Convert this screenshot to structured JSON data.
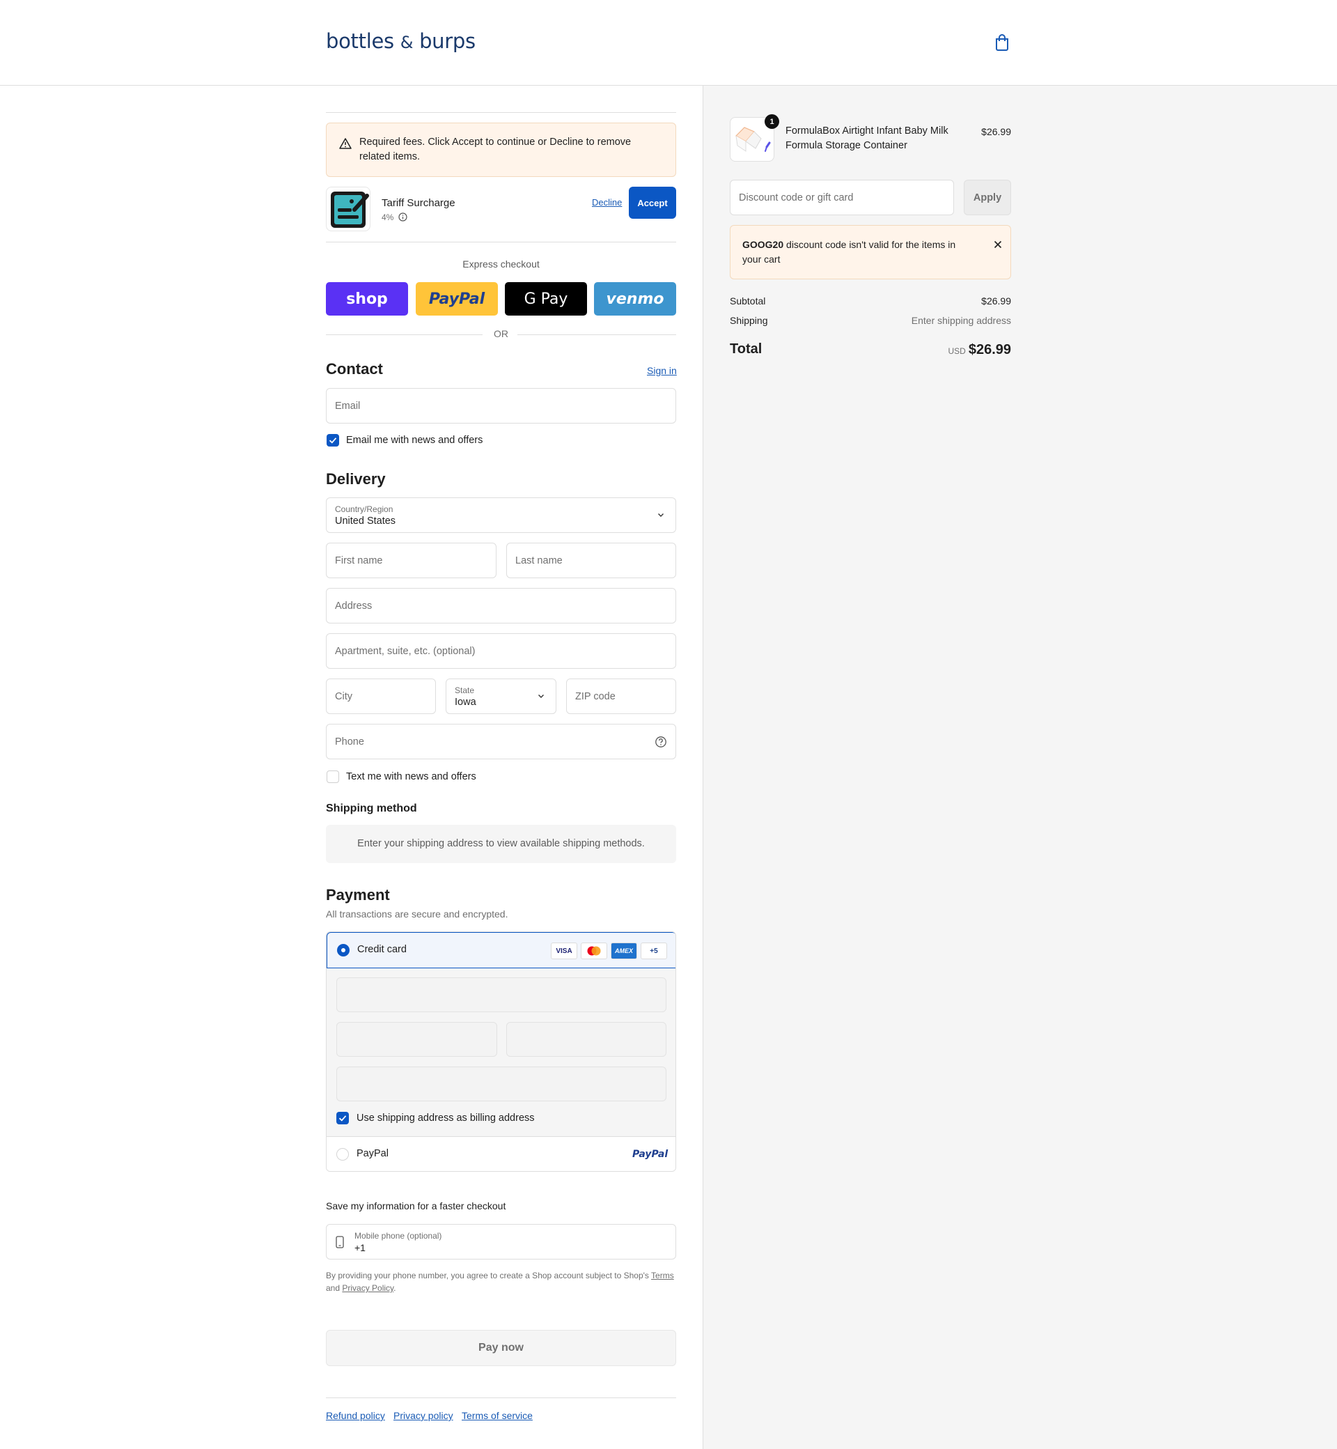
{
  "header": {
    "logo_text": "bottles",
    "logo_amp": "&",
    "logo_text2": "burps",
    "cart_icon": "shopping-bag-icon"
  },
  "fees_notice": {
    "icon": "warning-triangle-icon",
    "text": "Required fees. Click Accept to continue or Decline to remove related items."
  },
  "tariff": {
    "name": "Tariff Surcharge",
    "percent": "4%",
    "decline_label": "Decline",
    "accept_label": "Accept",
    "info_icon": "info-icon"
  },
  "express": {
    "title": "Express checkout",
    "buttons": [
      "shop",
      "PayPal",
      "G Pay",
      "venmo"
    ],
    "or_label": "OR"
  },
  "contact": {
    "title": "Contact",
    "sign_in_label": "Sign in",
    "email_placeholder": "Email",
    "newsletter_label": "Email me with news and offers",
    "newsletter_checked": true
  },
  "delivery": {
    "title": "Delivery",
    "country_label": "Country/Region",
    "country_value": "United States",
    "first_name_placeholder": "First name",
    "last_name_placeholder": "Last name",
    "address_placeholder": "Address",
    "apartment_placeholder": "Apartment, suite, etc. (optional)",
    "city_placeholder": "City",
    "state_label": "State",
    "state_value": "Iowa",
    "zip_placeholder": "ZIP code",
    "phone_placeholder": "Phone",
    "text_offers_label": "Text me with news and offers",
    "text_offers_checked": false
  },
  "shipping_method": {
    "title": "Shipping method",
    "message": "Enter your shipping address to view available shipping methods."
  },
  "payment": {
    "title": "Payment",
    "subtitle": "All transactions are secure and encrypted.",
    "credit_card_label": "Credit card",
    "card_badges": [
      "VISA",
      "",
      "AMEX",
      "+5"
    ],
    "billing_same_label": "Use shipping address as billing address",
    "billing_same_checked": true,
    "paypal_label": "PayPal",
    "paypal_logo": "PayPal"
  },
  "save_info": {
    "title": "Save my information for a faster checkout",
    "phone_label": "Mobile phone (optional)",
    "phone_value": "+1",
    "disclaimer_pre": "By providing your phone number, you agree to create a Shop account subject to Shop's",
    "terms_label": "Terms",
    "disclaimer_and": "and",
    "privacy_label": "Privacy Policy",
    "disclaimer_end": "."
  },
  "pay_now_label": "Pay now",
  "footer": {
    "links": [
      "Refund policy",
      "Privacy policy",
      "Terms of service"
    ]
  },
  "order": {
    "product_name": "FormulaBox Airtight Infant Baby Milk Formula Storage Container",
    "product_price": "$26.99",
    "quantity": "1",
    "discount_placeholder": "Discount code or gift card",
    "apply_label": "Apply",
    "error_code": "GOOG20",
    "error_text": " discount code isn't valid for the items in your cart",
    "subtotal_label": "Subtotal",
    "subtotal_value": "$26.99",
    "shipping_label": "Shipping",
    "shipping_value": "Enter shipping address",
    "total_label": "Total",
    "total_currency": "USD",
    "total_value": "$26.99"
  },
  "colors": {
    "accent": "#0b57c4",
    "shop": "#5a31f4",
    "paypal": "#ffc439",
    "venmo": "#3d95ce",
    "notice_bg": "#fff4ea"
  }
}
